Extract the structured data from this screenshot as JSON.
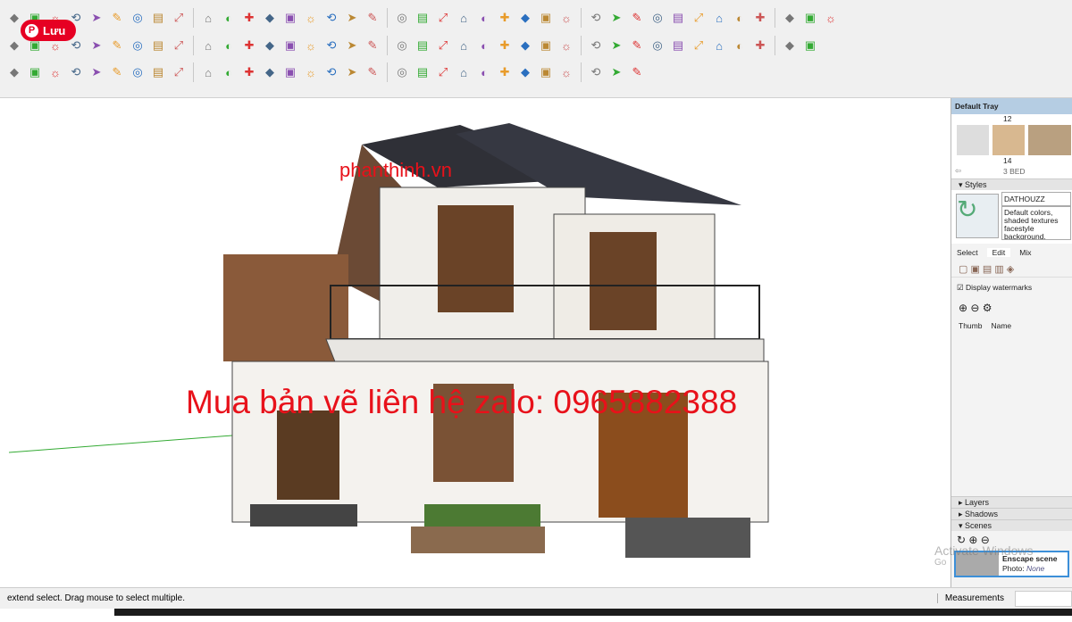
{
  "pinterest": {
    "label": "Lưu",
    "icon": "pinterest-icon"
  },
  "toolbars": {
    "row1": [
      "rotated-rect",
      "freehand",
      "arc",
      "pie",
      "follow-me",
      "rotate",
      "scale",
      "offset",
      "line",
      "line-alt",
      "circle",
      "polygon",
      "tape",
      "text",
      "axes",
      "dimension",
      "protractor",
      "section",
      "orbit",
      "pan",
      "zoom",
      "zoom-window",
      "walk",
      "look-around",
      "position-camera",
      "sandbox-smoove",
      "sandbox-stamp",
      "sandbox-drape",
      "sandbox-add-detail",
      "sandbox-flip",
      "grid",
      "contours",
      "from-scratch",
      "components",
      "materials",
      "layers",
      "shadows",
      "fog",
      "scenes"
    ],
    "row2": [
      "select",
      "make-component",
      "paint",
      "eraser",
      "tape",
      "protractor",
      "text",
      "axes",
      "3d-text",
      "pencil",
      "arc",
      "rectangle",
      "shape",
      "circle",
      "polygon",
      "pie",
      "curve",
      "offset",
      "move",
      "push-pull",
      "rotate",
      "follow-me",
      "scale",
      "zoom",
      "zoom-extents",
      "orbit",
      "pan",
      "walk",
      "select-arrow",
      "component",
      "paint-bucket",
      "erase",
      "warehouse",
      "extension",
      "share",
      "upload",
      "photo",
      "terrain"
    ],
    "row3": [
      "dropdown",
      "move",
      "follow-me",
      "explode",
      "rotate",
      "scale",
      "tape",
      "text",
      "paint",
      "orbit",
      "pan",
      "zoom",
      "zoom-extents",
      "warehouse",
      "extension",
      "render",
      "import",
      "ruby",
      "layout",
      "enscape-start",
      "sync",
      "capture",
      "add",
      "tree",
      "landscape",
      "checker",
      "cloud",
      "settings",
      "mail",
      "info"
    ]
  },
  "viewport": {
    "watermark_site": "phanthinh.vn",
    "watermark_contact": "Mua bản vẽ liên hệ zalo: 0965882388"
  },
  "tray": {
    "title": "Default Tray",
    "components": {
      "top_label": "12",
      "item_label": "14",
      "collection": "3 BED"
    },
    "styles": {
      "header": "Styles",
      "name": "DATHOUZZ",
      "description": "Default colors, shaded textures facestyle background.",
      "tabs": [
        "Select",
        "Edit",
        "Mix"
      ],
      "watermark_checkbox": "Display watermarks",
      "watermark_checked": true,
      "columns": [
        "Thumb",
        "Name"
      ]
    },
    "layers": "Layers",
    "shadows": "Shadows",
    "scenes": "Scenes",
    "scene": {
      "name": "Enscape scene",
      "photo_label": "Photo:",
      "photo_value": "None"
    }
  },
  "activate": {
    "line1": "Activate Windows",
    "line2": "Go"
  },
  "status": {
    "message": "extend select. Drag mouse to select multiple.",
    "measurements": "Measurements"
  },
  "colors": {
    "watermark": "#e8111a",
    "tray_header": "#b5cde3",
    "pinterest": "#e60023"
  }
}
